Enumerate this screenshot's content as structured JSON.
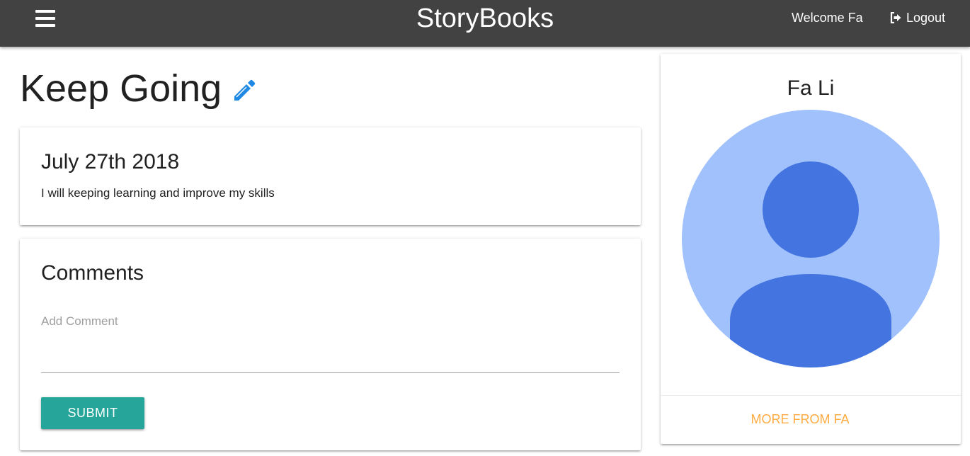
{
  "navbar": {
    "brand": "StoryBooks",
    "welcome": "Welcome Fa",
    "logout_label": "Logout"
  },
  "story": {
    "title": "Keep Going",
    "date": "July 27th 2018",
    "body": "I will keeping learning and improve my skills"
  },
  "comments": {
    "title": "Comments",
    "input_label": "Add Comment",
    "input_value": "",
    "submit_label": "SUBMIT"
  },
  "author": {
    "name": "Fa Li",
    "more_link": "MORE FROM FA"
  },
  "icons": {
    "menu": "hamburger-menu-icon",
    "logout": "sign-out-icon",
    "edit": "pencil-icon",
    "avatar": "default-user-avatar"
  },
  "colors": {
    "navbar": "#424242",
    "submit": "#26a69a",
    "edit_icon": "#1e88e5",
    "more_link": "#ffab40",
    "avatar_bg": "#a0c1fc",
    "avatar_fg": "#4374e0"
  }
}
